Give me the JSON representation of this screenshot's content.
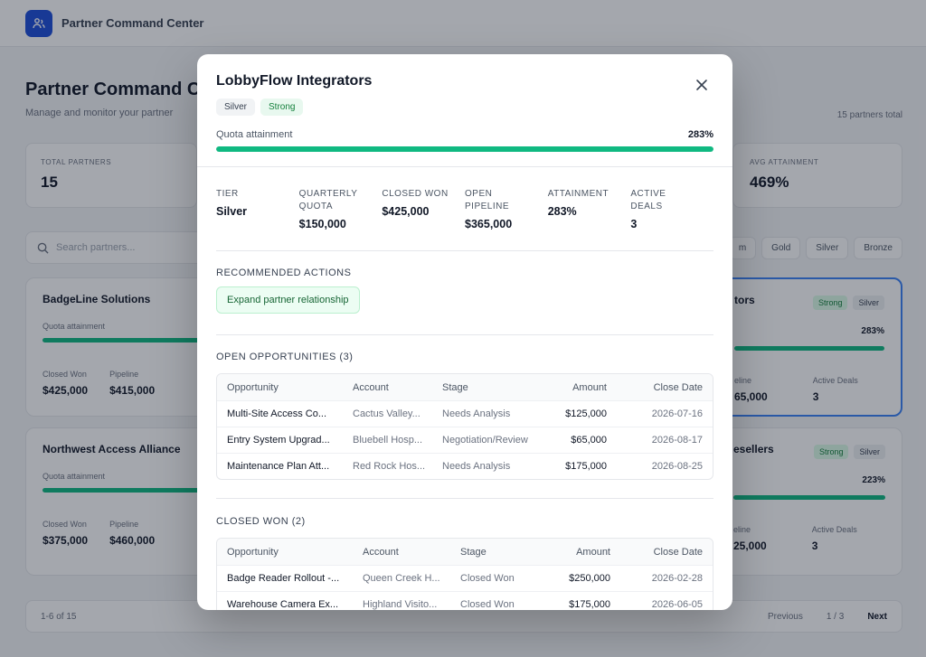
{
  "app": {
    "title": "Partner Command Center",
    "page_title": "Partner Command C",
    "page_subtitle": "Manage and monitor your partner",
    "partners_total": "15 partners total",
    "stats": [
      {
        "label": "Total Partners",
        "value": "15"
      },
      {
        "label": "Avg Attainment",
        "value": "469%"
      }
    ],
    "search_placeholder": "Search partners...",
    "filter_tabs": [
      "m",
      "Gold",
      "Silver",
      "Bronze"
    ],
    "cards": [
      {
        "name": "BadgeLine Solutions",
        "sub": "Quota attainment",
        "m1_label": "Closed Won",
        "m1_value": "$425,000",
        "m2_label": "Pipeline",
        "m2_value": "$415,000"
      },
      {
        "name": "Northwest Access Alliance",
        "sub": "Quota attainment",
        "m1_label": "Closed Won",
        "m1_value": "$375,000",
        "m2_label": "Pipeline",
        "m2_value": "$460,000"
      },
      {
        "name": "tors",
        "chip1": "Strong",
        "chip2": "Silver",
        "pct": "283%",
        "m1_label": "eline",
        "m1_value": "65,000",
        "m2_label": "Active Deals",
        "m2_value": "3"
      },
      {
        "name": "esellers",
        "chip1": "Strong",
        "chip2": "Silver",
        "pct": "223%",
        "m1_label": "eline",
        "m1_value": "25,000",
        "m2_label": "Active Deals",
        "m2_value": "3"
      }
    ],
    "pager": {
      "range": "1-6 of 15",
      "previous": "Previous",
      "page": "1 / 3",
      "next": "Next"
    }
  },
  "modal": {
    "title": "LobbyFlow Integrators",
    "tier_chip": "Silver",
    "status_chip": "Strong",
    "quota_label": "Quota attainment",
    "quota_pct": "283%",
    "quota_fill": 1.0,
    "metrics": [
      {
        "label": "Tier",
        "value": "Silver"
      },
      {
        "label": "Quarterly Quota",
        "value": "$150,000"
      },
      {
        "label": "Closed Won",
        "value": "$425,000"
      },
      {
        "label": "Open Pipeline",
        "value": "$365,000"
      },
      {
        "label": "Attainment",
        "value": "283%"
      },
      {
        "label": "Active Deals",
        "value": "3"
      }
    ],
    "recommended": {
      "title": "Recommended Actions",
      "action": "Expand partner relationship"
    },
    "open_opps": {
      "title": "Open Opportunities (3)",
      "headers": [
        "Opportunity",
        "Account",
        "Stage",
        "Amount",
        "Close Date"
      ],
      "rows": [
        [
          "Multi-Site Access Co...",
          "Cactus Valley...",
          "Needs Analysis",
          "$125,000",
          "2026-07-16"
        ],
        [
          "Entry System Upgrad...",
          "Bluebell Hosp...",
          "Negotiation/Review",
          "$65,000",
          "2026-08-17"
        ],
        [
          "Maintenance Plan Att...",
          "Red Rock Hos...",
          "Needs Analysis",
          "$175,000",
          "2026-08-25"
        ]
      ]
    },
    "closed_won": {
      "title": "Closed Won (2)",
      "headers": [
        "Opportunity",
        "Account",
        "Stage",
        "Amount",
        "Close Date"
      ],
      "rows": [
        [
          "Badge Reader Rollout -...",
          "Queen Creek H...",
          "Closed Won",
          "$250,000",
          "2026-02-28"
        ],
        [
          "Warehouse Camera Ex...",
          "Highland Visito...",
          "Closed Won",
          "$175,000",
          "2026-06-05"
        ]
      ]
    }
  }
}
